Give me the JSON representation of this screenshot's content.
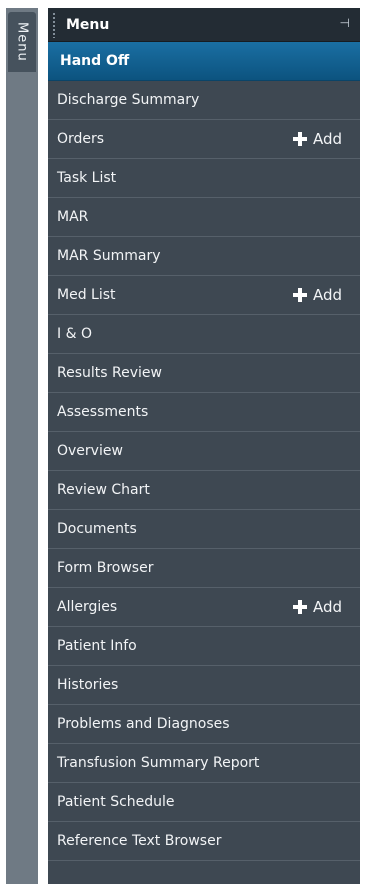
{
  "sidebar_tab": {
    "label": "Menu"
  },
  "menu": {
    "title": "Menu",
    "pin_icon": "pin-icon",
    "items": [
      {
        "label": "Hand Off",
        "active": true
      },
      {
        "label": "Discharge Summary"
      },
      {
        "label": "Orders",
        "add_label": "Add"
      },
      {
        "label": "Task List"
      },
      {
        "label": "MAR"
      },
      {
        "label": "MAR Summary"
      },
      {
        "label": "Med List",
        "add_label": "Add"
      },
      {
        "label": "I & O"
      },
      {
        "label": "Results Review"
      },
      {
        "label": "Assessments"
      },
      {
        "label": "Overview"
      },
      {
        "label": "Review Chart"
      },
      {
        "label": "Documents"
      },
      {
        "label": "Form Browser"
      },
      {
        "label": "Allergies",
        "add_label": "Add"
      },
      {
        "label": "Patient Info"
      },
      {
        "label": "Histories"
      },
      {
        "label": "Problems and Diagnoses"
      },
      {
        "label": "Transfusion Summary Report"
      },
      {
        "label": "Patient Schedule"
      },
      {
        "label": "Reference Text Browser"
      }
    ]
  },
  "colors": {
    "panel_bg": "#3e4852",
    "header_bg": "#232c34",
    "active_bg": "#0c537f",
    "side_tab_bg": "#6f7a84"
  }
}
